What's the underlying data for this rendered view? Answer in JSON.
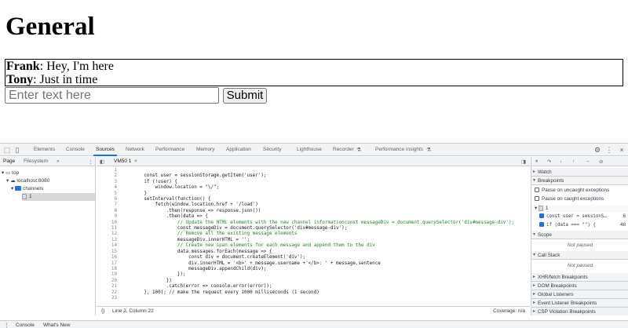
{
  "page": {
    "title": "General",
    "messages": [
      {
        "user": "Frank",
        "text": ": Hey, I'm here"
      },
      {
        "user": "Tony",
        "text": ": Just in time"
      }
    ],
    "input_placeholder": "Enter text here",
    "submit_label": "Submit"
  },
  "devtools": {
    "tabs": [
      "Elements",
      "Console",
      "Sources",
      "Network",
      "Performance",
      "Memory",
      "Application",
      "Security",
      "Lighthouse",
      "Recorder",
      "Performance insights"
    ],
    "active_tab": "Sources",
    "more_tabs": "»",
    "nav_tabs": [
      "Page",
      "Filesystem"
    ],
    "nav_more": "»",
    "tree": {
      "top": "top",
      "host": "localhost:8080",
      "folder": "channels",
      "file": "1"
    },
    "editor_tab": "VM50 1",
    "editor_tab_close": "×",
    "code_lines": [
      "",
      "        const user = sessionStorage.getItem('user');",
      "        if (!user) {",
      "            window.location = \"\\/\";",
      "        }",
      "        setInterval(function() {",
      "            fetch(window.location.href + '/load')",
      "                .then(response => response.json())",
      "                .then(data => {",
      "                    // Update the HTML elements with the new channel informationconst messageDiv = document.querySelector('div#message-div');",
      "                    const messageDiv = document.querySelector('div#message-div');",
      "                    // Remove all the existing message elements",
      "                    messageDiv.innerHTML = '';",
      "                    // Create new span elements for each message and append them to the div",
      "                    data.messages.forEach(message => {",
      "                        const div = document.createElement('div');",
      "                        div.innerHTML = '<b>' + message.username +'</b>: ' + message.sentence",
      "                        messageDiv.appendChild(div);",
      "                    });",
      "                })",
      "                .catch(error => console.error(error));",
      "        }, 100); // make the request every 1000 milliseconds (1 second)",
      ""
    ],
    "status_left": "Line 2, Column 22",
    "status_braces": "{}",
    "status_right": "Coverage: n/a",
    "debugger": {
      "sections": {
        "watch": "Watch",
        "breakpoints": "Breakpoints",
        "scope": "Scope",
        "call_stack": "Call Stack",
        "xhr": "XHR/fetch Breakpoints",
        "dom": "DOM Breakpoints",
        "global": "Global Listeners",
        "event": "Event Listener Breakpoints",
        "csp": "CSP Violation Breakpoints"
      },
      "pause_uncaught": "Pause on uncaught exceptions",
      "pause_caught": "Pause on caught exceptions",
      "bp_file": "1",
      "bp1_code": "const user = sessionS…",
      "bp1_line": "6",
      "bp2_code": "if (data === \"\") {",
      "bp2_line": "48",
      "not_paused_1": "Not paused",
      "not_paused_2": "Not paused"
    },
    "drawer_tabs": [
      "Console",
      "What's New"
    ]
  },
  "colors": {
    "accent": "#1a73e8",
    "chrome_bg": "#f1f3f4"
  }
}
